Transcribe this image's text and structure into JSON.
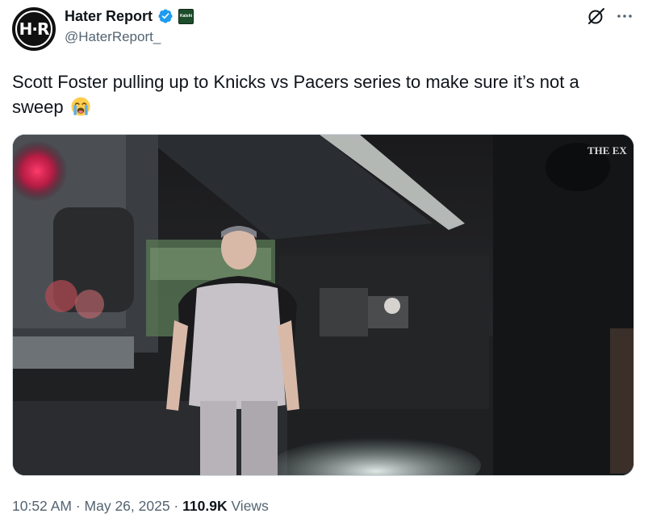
{
  "author": {
    "avatar_text": "H·R",
    "display_name": "Hater Report",
    "handle": "@HaterReport_",
    "affiliate_badge_text": "Kalshi",
    "verified": true
  },
  "tweet": {
    "text": "Scott Foster pulling up to Knicks vs Pacers series to make sure it’s not a sweep",
    "emoji": "loudly-crying-face"
  },
  "media": {
    "watermark": "THE EX"
  },
  "meta": {
    "time": "10:52 AM",
    "separator1": " · ",
    "date": "May 26, 2025",
    "separator2": " · ",
    "views_count": "110.9K",
    "views_label": " Views"
  },
  "icons": [
    "verified-icon",
    "grok-icon",
    "more-icon",
    "loudly-crying-face-emoji"
  ],
  "colors": {
    "text_primary": "#0f1419",
    "text_secondary": "#536471",
    "verified_blue": "#1d9bf0",
    "border": "#cfd9de"
  }
}
